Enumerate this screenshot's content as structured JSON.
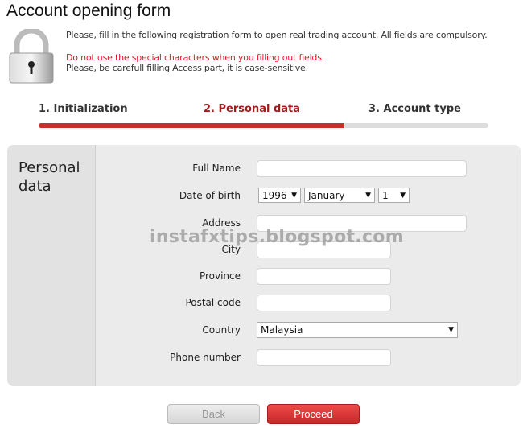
{
  "title": "Account opening form",
  "intro": "Please, fill in the following registration form to open real trading account. All fields are compulsory.",
  "warning": "Do not use the special characters when you filling out fields.",
  "note": "Please, be carefull filling Access part, it is case-sensitive.",
  "steps": [
    {
      "label": "1. Initialization"
    },
    {
      "label": "2. Personal data"
    },
    {
      "label": "3. Account type"
    }
  ],
  "progress_percent": 68,
  "section_title": "Personal data",
  "fields": {
    "full_name": {
      "label": "Full Name",
      "value": ""
    },
    "dob": {
      "label": "Date of birth",
      "year": "1996",
      "month": "January",
      "day": "1"
    },
    "address": {
      "label": "Address",
      "value": ""
    },
    "city": {
      "label": "City",
      "value": ""
    },
    "province": {
      "label": "Province",
      "value": ""
    },
    "postal": {
      "label": "Postal code",
      "value": ""
    },
    "country": {
      "label": "Country",
      "value": "Malaysia"
    },
    "phone": {
      "label": "Phone number",
      "value": ""
    }
  },
  "watermark": "instafxtips.blogspot.com",
  "buttons": {
    "back": "Back",
    "proceed": "Proceed"
  },
  "colors": {
    "accent": "#c8302c",
    "active_step": "#a31c1c",
    "warning": "#e0182a"
  }
}
